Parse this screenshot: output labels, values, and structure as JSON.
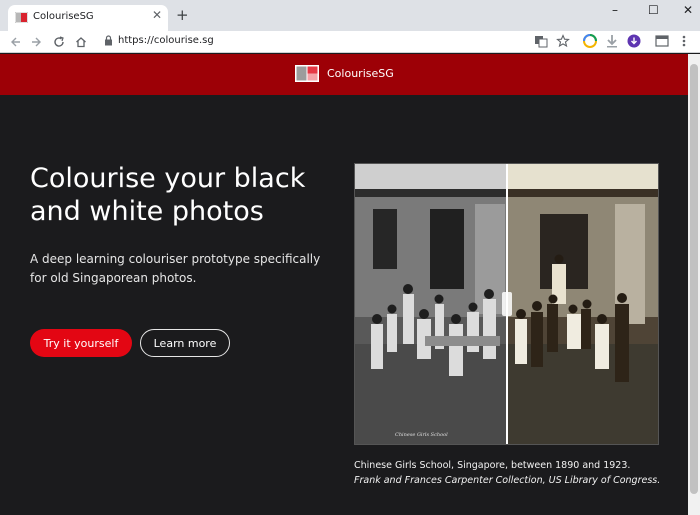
{
  "browser": {
    "tab_title": "ColouriseSG",
    "tab_close_glyph": "✕",
    "new_tab_glyph": "+",
    "url": "https://colourise.sg",
    "window_controls": [
      "–",
      "☐",
      "✕"
    ]
  },
  "header": {
    "brand": "ColouriseSG",
    "color": "#9d0006"
  },
  "hero": {
    "title": "Colourise your black and white photos",
    "subtitle": "A deep learning colouriser prototype specifically for old Singaporean photos.",
    "primary_button": "Try it yourself",
    "secondary_button": "Learn more",
    "accent": "#e30613"
  },
  "photo": {
    "overlay_text": "Chinese Girls School",
    "caption_line1": "Chinese Girls School, Singapore, between 1890 and 1923.",
    "caption_line2": "Frank and Frances Carpenter Collection, US Library of Congress."
  },
  "icons": [
    "back-icon",
    "forward-icon",
    "reload-icon",
    "home-icon",
    "lock-icon",
    "translate-icon",
    "star-icon",
    "extension-icon",
    "download-icon",
    "profile-icon",
    "menu-icon"
  ]
}
